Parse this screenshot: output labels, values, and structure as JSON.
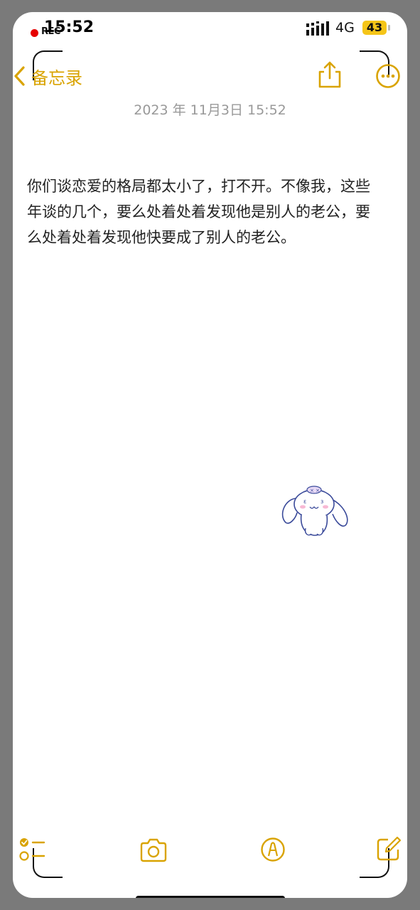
{
  "status_bar": {
    "rec_label": "REC",
    "time": "15:52",
    "network": "4G",
    "battery": "43"
  },
  "nav": {
    "back_label": "备忘录"
  },
  "note": {
    "date": "2023 年 11月3日 15:52",
    "body": "你们谈恋爱的格局都太小了，打不开。不像我，这些年谈的几个，要么处着处着发现他是别人的老公，要么处着处着发现他快要成了别人的老公。"
  },
  "icons": {
    "back": "chevron-left-icon",
    "share": "share-icon",
    "more": "ellipsis-circle-icon",
    "checklist": "checklist-icon",
    "camera": "camera-icon",
    "markup": "markup-pen-icon",
    "compose": "compose-icon",
    "sticker": "bunny-sticker"
  },
  "colors": {
    "accent": "#d9a300",
    "recording": "#e60000",
    "battery": "#f5c518",
    "text": "#222222",
    "date": "#999999"
  }
}
